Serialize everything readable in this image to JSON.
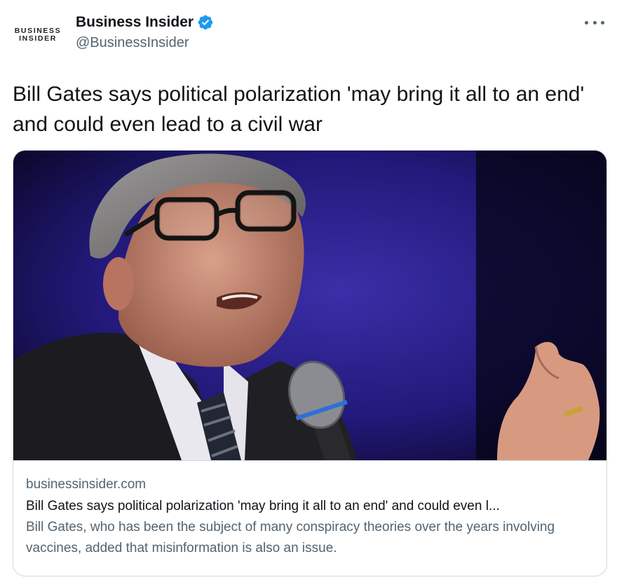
{
  "account": {
    "logo_line1": "BUSINESS",
    "logo_line2": "INSIDER",
    "display_name": "Business Insider",
    "handle": "@BusinessInsider",
    "verified": true,
    "verified_color": "#1d9bf0"
  },
  "tweet": {
    "text": "Bill Gates says political polarization 'may bring it all to an end' and could even lead to a civil war"
  },
  "card": {
    "image_icon": "photo-of-speaker-with-microphone",
    "domain": "businessinsider.com",
    "title": "Bill Gates says political polarization 'may bring it all to an end' and could even l...",
    "description": "Bill Gates, who has been the subject of many conspiracy theories over the years involving vaccines, added that misinformation is also an issue."
  },
  "colors": {
    "text_primary": "#0f1419",
    "text_secondary": "#536471",
    "border": "#cfd9de"
  }
}
